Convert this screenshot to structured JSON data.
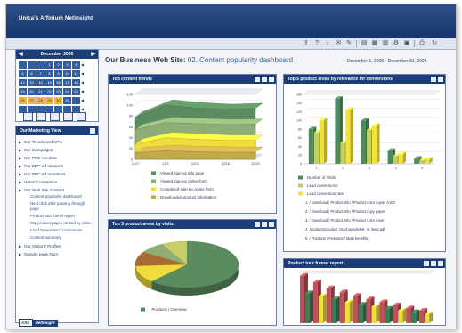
{
  "brand": "Unica's Affinium NetInsight",
  "toolbar": {
    "icons": [
      "export-icon",
      "help-icon",
      "download-icon",
      "email-icon",
      "envelope-icon",
      "print-icon",
      "table-icon",
      "chart-icon",
      "settings-icon",
      "print-preview-icon",
      "options-icon"
    ]
  },
  "calendar": {
    "title": "December 2005",
    "rows": [
      [
        "",
        "",
        "",
        "1",
        "2",
        "3",
        "4"
      ],
      [
        "5",
        "6",
        "7",
        "8",
        "9",
        "10",
        "11"
      ],
      [
        "12",
        "13",
        "14",
        "15",
        "16",
        "17",
        "18"
      ],
      [
        "19",
        "20",
        "21",
        "22",
        "23",
        "24",
        "25"
      ],
      [
        "26",
        "27",
        "28",
        "29",
        "30",
        "31",
        ""
      ],
      [
        "",
        "",
        "",
        "",
        "",
        "",
        ""
      ]
    ]
  },
  "marketing_view": {
    "title": "Our Marketing View",
    "items": [
      {
        "label": "Our Trends and KPIs"
      },
      {
        "label": "Our Campaigns"
      },
      {
        "label": "Our PPC Vendors"
      },
      {
        "label": "Our PPC Ad Versions"
      },
      {
        "label": "Our PPC Ad Variations"
      },
      {
        "label": "Visitor Conversion"
      },
      {
        "label": "Our Web Site Content"
      }
    ],
    "subitems": [
      "Content popularity dashboard",
      "Next click after passing through page",
      "Product tour funnel report",
      "Top product pages ranked by visits",
      "Lead Generation Conversions",
      "Content summary"
    ],
    "items_after": [
      {
        "label": "Our Visitors' Profiles"
      },
      {
        "label": "Sample page Num"
      }
    ],
    "ask_label": "ASK",
    "netinsight_label": "NetInsight"
  },
  "page": {
    "title_prefix": "Our Business Web Site:",
    "title_sub": "02. Content popularity dashboard",
    "date_range": "December 1, 2005 - December 31, 2005"
  },
  "panels": {
    "trends": {
      "title": "Top content trends",
      "legend": [
        {
          "label": "Viewed sign-up info page",
          "color": "#5b8c5f"
        },
        {
          "label": "Viewed sign-up online form",
          "color": "#8fae77"
        },
        {
          "label": "Completed sign-up online form",
          "color": "#f0dc3c"
        },
        {
          "label": "Downloaded product information",
          "color": "#c2a94a"
        }
      ]
    },
    "relevance": {
      "title": "Top 5 product areas by relevance for conversions",
      "legend": [
        {
          "label": "Number of Visits",
          "color": "#4f8a5d"
        },
        {
          "label": "Lead conversions",
          "color": "#c5d05a"
        },
        {
          "label": "Lead conversion rate",
          "color": "#f3e23a"
        }
      ],
      "list": [
        "1. / Download / Product Info / Product color copier A100",
        "2. / Download / Product Info / Product copy paper",
        "3. / Download / Product Info / Product color toner",
        "4. /products/product_brochures/what_is_laser.pdf",
        "5. / Products / Features / Main benefits"
      ]
    },
    "visits": {
      "title": "Top 5 product areas by visits",
      "legend": [
        {
          "label": "/ Products / Overview",
          "color": "#5b8c5f"
        }
      ]
    },
    "funnel": {
      "title": "Product tour funnel report"
    }
  },
  "chart_data": [
    {
      "type": "area",
      "title": "Top content trends",
      "x": [
        "11/27",
        "12/4",
        "12/11",
        "12/18",
        "12/25"
      ],
      "ylim": [
        0,
        120
      ],
      "yticks": [
        "120",
        "100",
        "80",
        "60",
        "40",
        "20",
        "0"
      ],
      "series": [
        {
          "name": "Viewed sign-up info page",
          "values": [
            78,
            100,
            95,
            92,
            94
          ]
        },
        {
          "name": "Viewed sign-up online form",
          "values": [
            55,
            68,
            66,
            64,
            65
          ]
        },
        {
          "name": "Completed sign-up online form",
          "values": [
            28,
            40,
            37,
            35,
            35
          ]
        },
        {
          "name": "Downloaded product information",
          "values": [
            12,
            16,
            14,
            13,
            13
          ]
        }
      ]
    },
    {
      "type": "bar",
      "title": "Top 5 product areas by relevance for conversions",
      "categories": [
        "1",
        "2",
        "3",
        "4",
        "5"
      ],
      "ylim": [
        0,
        160
      ],
      "yticks": [
        "160",
        "140",
        "120",
        "100",
        "80",
        "60",
        "40",
        "20",
        "0"
      ],
      "series": [
        {
          "name": "Number of Visits",
          "values": [
            80,
            150,
            100,
            30,
            12
          ]
        },
        {
          "name": "Lead conversions",
          "values": [
            72,
            48,
            78,
            18,
            8
          ]
        },
        {
          "name": "Lead conversion rate",
          "values": [
            100,
            125,
            88,
            22,
            10
          ]
        }
      ]
    },
    {
      "type": "pie",
      "title": "Top 5 product areas by visits",
      "slices": [
        {
          "name": "/ Products / Overview",
          "value": 62,
          "color": "#5b8c5f"
        },
        {
          "name": "",
          "value": 12,
          "color": "#f0dc3c"
        },
        {
          "name": "",
          "value": 10,
          "color": "#a86b33"
        },
        {
          "name": "",
          "value": 8,
          "color": "#8fae77"
        },
        {
          "name": "",
          "value": 8,
          "color": "#c9cf67"
        }
      ]
    },
    {
      "type": "bar",
      "title": "Product tour funnel report",
      "categories": [
        "1",
        "2",
        "3",
        "4",
        "5",
        "6",
        "7",
        "8",
        "9",
        "10"
      ],
      "series": [
        {
          "name": "",
          "values": [
            95,
            82,
            70,
            62,
            55,
            48,
            42,
            36,
            30,
            25
          ]
        },
        {
          "name": "",
          "values": [
            60,
            54,
            48,
            42,
            37,
            33,
            29,
            25,
            22,
            18
          ]
        }
      ]
    }
  ]
}
